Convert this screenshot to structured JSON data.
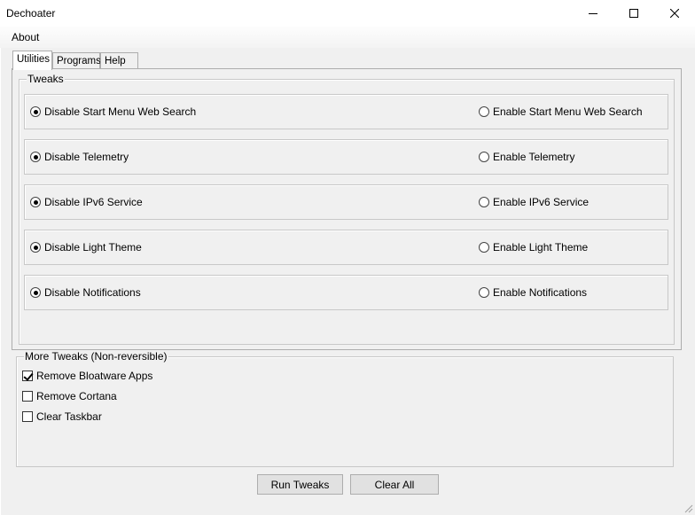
{
  "window": {
    "title": "Dechoater"
  },
  "menu": {
    "about": "About"
  },
  "tabs": [
    {
      "label": "Utilities",
      "active": true
    },
    {
      "label": "Programs",
      "active": false
    },
    {
      "label": "Help",
      "active": false
    }
  ],
  "tweaks": {
    "legend": "Tweaks",
    "rows": [
      {
        "disable": "Disable Start Menu Web Search",
        "enable": "Enable Start Menu Web Search",
        "selected": "disable"
      },
      {
        "disable": "Disable Telemetry",
        "enable": "Enable Telemetry",
        "selected": "disable"
      },
      {
        "disable": "Disable IPv6 Service",
        "enable": "Enable IPv6 Service",
        "selected": "disable"
      },
      {
        "disable": "Disable Light Theme",
        "enable": "Enable Light Theme",
        "selected": "disable"
      },
      {
        "disable": "Disable Notifications",
        "enable": "Enable Notifications",
        "selected": "disable"
      }
    ]
  },
  "more_tweaks": {
    "legend": "More Tweaks (Non-reversible)",
    "items": [
      {
        "label": "Remove Bloatware Apps",
        "checked": true
      },
      {
        "label": "Remove Cortana",
        "checked": false
      },
      {
        "label": "Clear Taskbar",
        "checked": false
      }
    ]
  },
  "buttons": {
    "run": "Run Tweaks",
    "clear": "Clear All"
  }
}
